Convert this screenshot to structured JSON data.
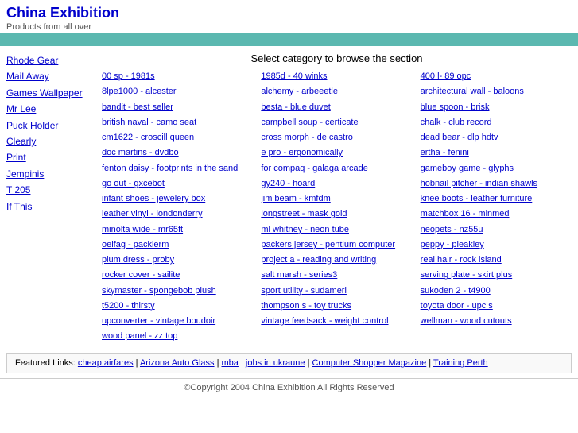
{
  "header": {
    "title": "China Exhibition",
    "title_href": "#",
    "tagline": "Products from all over"
  },
  "sidebar": {
    "links": [
      {
        "label": "Rhode Gear",
        "href": "#"
      },
      {
        "label": "Mail Away",
        "href": "#"
      },
      {
        "label": "Games Wallpaper",
        "href": "#"
      },
      {
        "label": "Mr Lee",
        "href": "#"
      },
      {
        "label": "Puck Holder",
        "href": "#"
      },
      {
        "label": "Clearly",
        "href": "#"
      },
      {
        "label": "Print",
        "href": "#"
      },
      {
        "label": "Jempinis",
        "href": "#"
      },
      {
        "label": "T 205",
        "href": "#"
      },
      {
        "label": "If This",
        "href": "#"
      }
    ]
  },
  "category_title": "Select category to browse the section",
  "links": {
    "col1": [
      {
        "label": "00 sp - 1981s",
        "href": "#"
      },
      {
        "label": "8lpe1000 - alcester",
        "href": "#"
      },
      {
        "label": "bandit - best seller",
        "href": "#"
      },
      {
        "label": "british naval - camo seat",
        "href": "#"
      },
      {
        "label": "cm1622 - croscill queen",
        "href": "#"
      },
      {
        "label": "doc martins - dvdbo",
        "href": "#"
      },
      {
        "label": "fenton daisy - footprints in the sand",
        "href": "#"
      },
      {
        "label": "go out - gxcebot",
        "href": "#"
      },
      {
        "label": "infant shoes - jewelery box",
        "href": "#"
      },
      {
        "label": "leather vinyl - londonderry",
        "href": "#"
      },
      {
        "label": "minolta wide - mr65ft",
        "href": "#"
      },
      {
        "label": "oelfag - packlerm",
        "href": "#"
      },
      {
        "label": "plum dress - proby",
        "href": "#"
      },
      {
        "label": "rocker cover - sailite",
        "href": "#"
      },
      {
        "label": "skymaster - spongebob plush",
        "href": "#"
      },
      {
        "label": "t5200 - thirsty",
        "href": "#"
      },
      {
        "label": "upconverter - vintage boudoir",
        "href": "#"
      },
      {
        "label": "wood panel - zz top",
        "href": "#"
      }
    ],
    "col2": [
      {
        "label": "1985d - 40 winks",
        "href": "#"
      },
      {
        "label": "alchemy - arbeeetle",
        "href": "#"
      },
      {
        "label": "besta - blue duvet",
        "href": "#"
      },
      {
        "label": "campbell soup - certicate",
        "href": "#"
      },
      {
        "label": "cross morph - de castro",
        "href": "#"
      },
      {
        "label": "e pro - ergonomically",
        "href": "#"
      },
      {
        "label": "for compaq - galaga arcade",
        "href": "#"
      },
      {
        "label": "gy240 - hoard",
        "href": "#"
      },
      {
        "label": "jim beam - kmfdm",
        "href": "#"
      },
      {
        "label": "longstreet - mask gold",
        "href": "#"
      },
      {
        "label": "ml whitney - neon tube",
        "href": "#"
      },
      {
        "label": "packers jersey - pentium computer",
        "href": "#"
      },
      {
        "label": "project a - reading and writing",
        "href": "#"
      },
      {
        "label": "salt marsh - series3",
        "href": "#"
      },
      {
        "label": "sport utility - sudameri",
        "href": "#"
      },
      {
        "label": "thompson s - toy trucks",
        "href": "#"
      },
      {
        "label": "vintage feedsack - weight control",
        "href": "#"
      }
    ],
    "col3": [
      {
        "label": "400 l- 89 opc",
        "href": "#"
      },
      {
        "label": "architectural wall - baloons",
        "href": "#"
      },
      {
        "label": "blue spoon - brisk",
        "href": "#"
      },
      {
        "label": "chalk - club record",
        "href": "#"
      },
      {
        "label": "dead bear - dlp hdtv",
        "href": "#"
      },
      {
        "label": "ertha - fenini",
        "href": "#"
      },
      {
        "label": "gameboy game - glyphs",
        "href": "#"
      },
      {
        "label": "hobnail pitcher - indian shawls",
        "href": "#"
      },
      {
        "label": "knee boots - leather furniture",
        "href": "#"
      },
      {
        "label": "matchbox 16 - minmed",
        "href": "#"
      },
      {
        "label": "neopets - nz55u",
        "href": "#"
      },
      {
        "label": "peppy - pleakley",
        "href": "#"
      },
      {
        "label": "real hair - rock island",
        "href": "#"
      },
      {
        "label": "serving plate - skirt plus",
        "href": "#"
      },
      {
        "label": "sukoden 2 - t4900",
        "href": "#"
      },
      {
        "label": "toyota door - upc s",
        "href": "#"
      },
      {
        "label": "wellman - wood cutouts",
        "href": "#"
      }
    ]
  },
  "featured": {
    "prefix": "Featured Links:",
    "links": [
      {
        "label": "cheap airfares",
        "href": "#"
      },
      {
        "label": "Arizona Auto Glass",
        "href": "#"
      },
      {
        "label": "mba",
        "href": "#"
      },
      {
        "label": "jobs in ukraune",
        "href": "#"
      },
      {
        "label": "Computer Shopper Magazine",
        "href": "#"
      },
      {
        "label": "Training Perth",
        "href": "#"
      }
    ]
  },
  "footer": {
    "text": "©Copyright 2004 China Exhibition All Rights Reserved"
  }
}
